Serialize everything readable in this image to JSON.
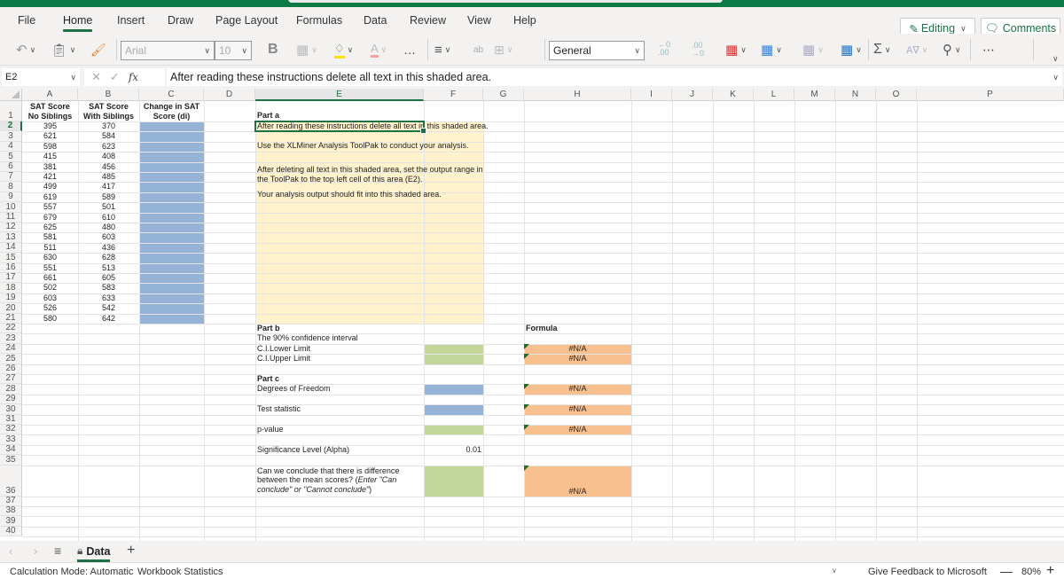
{
  "ribbon_tabs": [
    {
      "label": "File",
      "active": false
    },
    {
      "label": "Home",
      "active": true
    },
    {
      "label": "Insert",
      "active": false
    },
    {
      "label": "Draw",
      "active": false
    },
    {
      "label": "Page Layout",
      "active": false
    },
    {
      "label": "Formulas",
      "active": false
    },
    {
      "label": "Data",
      "active": false
    },
    {
      "label": "Review",
      "active": false
    },
    {
      "label": "View",
      "active": false
    },
    {
      "label": "Help",
      "active": false
    }
  ],
  "header_buttons": {
    "editing": "Editing",
    "comments": "Comments"
  },
  "toolbar": {
    "font_name": "Arial",
    "font_size": "10",
    "bold": "B",
    "number_format": "General",
    "more": "…",
    "icons": [
      "undo-icon",
      "paste-icon",
      "format-painter-icon",
      "borders-icon",
      "fill-color-icon",
      "font-color-icon",
      "align-icon",
      "wrap-text-icon",
      "merge-icon",
      "increase-decimal-icon",
      "decrease-decimal-icon",
      "conditional-format-icon",
      "format-as-table-icon",
      "cell-styles-icon",
      "insert-cells-icon",
      "autosum-icon",
      "sort-filter-icon",
      "find-icon"
    ]
  },
  "formula_bar": {
    "name_box": "E2",
    "formula": "After reading these instructions delete all text in this shaded area.",
    "fx": "fx"
  },
  "columns": [
    "A",
    "B",
    "C",
    "D",
    "E",
    "F",
    "G",
    "H",
    "I",
    "J",
    "K",
    "L",
    "M",
    "N",
    "O",
    "P"
  ],
  "selected_cell": {
    "column": "E",
    "row": "2"
  },
  "rows": [
    "1",
    "2",
    "3",
    "4",
    "5",
    "6",
    "7",
    "8",
    "9",
    "10",
    "11",
    "12",
    "13",
    "14",
    "15",
    "16",
    "17",
    "18",
    "19",
    "20",
    "21",
    "22",
    "23",
    "24",
    "25",
    "26",
    "27",
    "28",
    "29",
    "30",
    "31",
    "32",
    "33",
    "34",
    "35",
    "36",
    "37",
    "38",
    "39",
    "40"
  ],
  "table": {
    "headers": {
      "A": "SAT Score No Siblings",
      "B": "SAT Score With Siblings",
      "C": "Change in SAT Score (di)"
    },
    "values_a": [
      395,
      621,
      598,
      415,
      381,
      421,
      499,
      619,
      557,
      679,
      625,
      581,
      511,
      630,
      551,
      661,
      502,
      603,
      526,
      580
    ],
    "values_b": [
      370,
      584,
      623,
      408,
      456,
      485,
      417,
      589,
      501,
      610,
      480,
      603,
      436,
      628,
      513,
      605,
      583,
      633,
      542,
      642
    ]
  },
  "part_a": {
    "title": "Part a",
    "line1": "After reading these instructions delete all text in this shaded area.",
    "line2": "Use the XLMiner Analysis ToolPak to conduct your analysis.",
    "line3a": "After deleting all text in this shaded area, set the output range in",
    "line3b": "the ToolPak to the top left cell of this area (E2).",
    "line4": "Your analysis output should fit into this shaded area."
  },
  "part_b": {
    "title": "Part b",
    "ci_label": "The 90% confidence interval",
    "lower": "C.I.Lower Limit",
    "upper": "C.I.Upper Limit"
  },
  "part_c": {
    "title": "Part c",
    "df": "Degrees of Freedom",
    "test_stat": "Test statistic",
    "p_value": "p-value",
    "alpha_label": "Significance Level (Alpha)",
    "alpha_value": "0.01",
    "conclude_1": "Can we conclude that there is difference",
    "conclude_2": "between the mean scores? (",
    "conclude_2i": "Enter \"Can",
    "conclude_3i": "conclude\" or \"Cannot conclude\"",
    "conclude_3": ")"
  },
  "formula_column": {
    "header": "Formula",
    "values": [
      "#N/A",
      "#N/A",
      "#N/A",
      "#N/A",
      "#N/A",
      "#N/A"
    ]
  },
  "colors": {
    "instruction_fill": "#fff2cc",
    "blue_fill": "#95b3d7",
    "green_fill": "#c4d79b",
    "orange_fill": "#f8c08f",
    "brand_green": "#1e7145"
  },
  "sheet_tabs": [
    {
      "label": "Data",
      "active": true,
      "locked": true
    }
  ],
  "status_bar": {
    "calc_mode": "Calculation Mode: Automatic",
    "workbook_stats": "Workbook Statistics",
    "feedback": "Give Feedback to Microsoft",
    "zoom": "80%"
  }
}
